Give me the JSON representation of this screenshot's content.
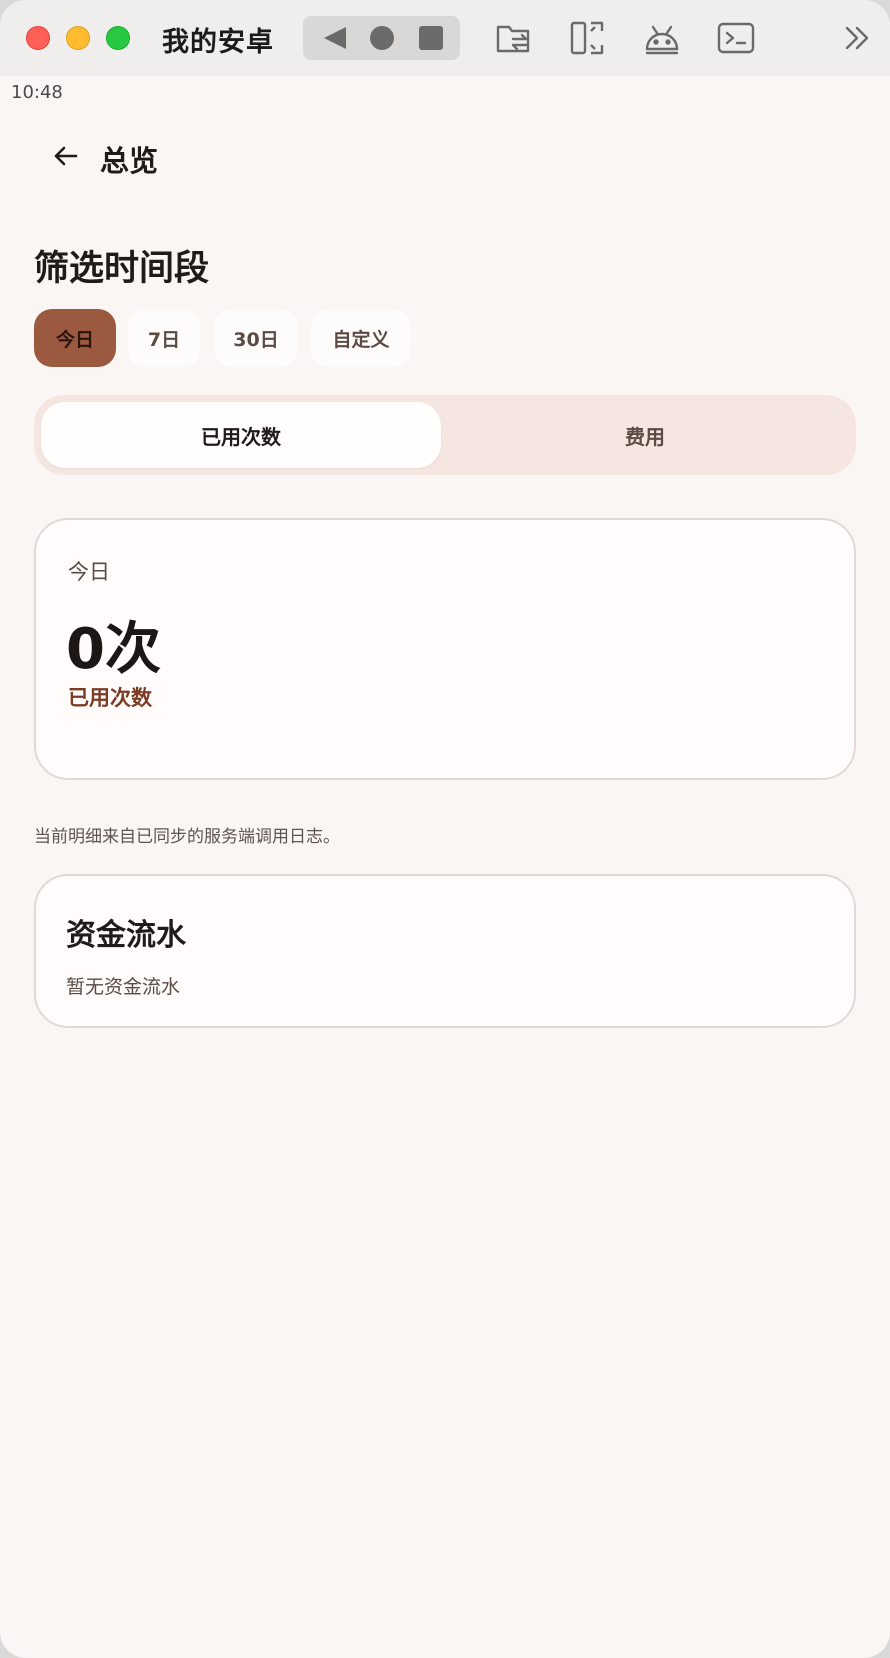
{
  "window": {
    "title": "我的安卓"
  },
  "status_bar": {
    "time": "10:48"
  },
  "app_bar": {
    "title": "总览"
  },
  "filter": {
    "title": "筛选时间段",
    "chips": [
      {
        "label": "今日",
        "selected": true
      },
      {
        "label": "7日",
        "selected": false
      },
      {
        "label": "30日",
        "selected": false
      },
      {
        "label": "自定义",
        "selected": false
      }
    ]
  },
  "segment": {
    "options": [
      {
        "label": "已用次数",
        "selected": true
      },
      {
        "label": "费用",
        "selected": false
      }
    ]
  },
  "stat_card": {
    "period": "今日",
    "value": "0次",
    "label": "已用次数"
  },
  "note": "当前明细来自已同步的服务端调用日志。",
  "flow_card": {
    "title": "资金流水",
    "empty_text": "暂无资金流水"
  },
  "colors": {
    "accent": "#9b5a3f",
    "background": "#faf6f3",
    "segment_bg": "#f6e6e2",
    "stat_label": "#7a3c24"
  },
  "icons": {
    "toolbar": [
      "folder-transfer-icon",
      "split-screen-icon",
      "android-icon",
      "terminal-icon",
      "chevron-double-right-icon"
    ]
  }
}
